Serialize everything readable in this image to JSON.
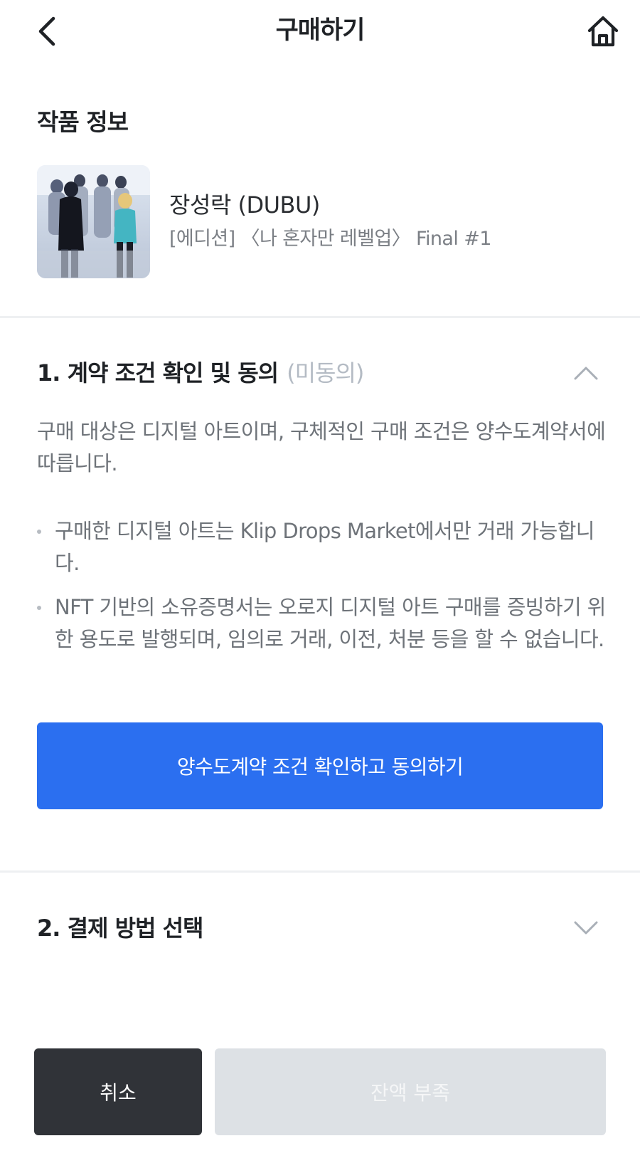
{
  "header": {
    "title": "구매하기",
    "back_icon": "chevron-left-icon",
    "home_icon": "home-icon"
  },
  "artwork_info": {
    "section_title": "작품 정보",
    "artist": "장성락 (DUBU)",
    "title": "[에디션] 〈나 혼자만 레벨업〉 Final #1"
  },
  "contract": {
    "title": "1. 계약 조건 확인 및 동의",
    "status": "(미동의)",
    "expanded": true,
    "description": "구매 대상은 디지털 아트이며, 구체적인 구매 조건은 양수도계약서에 따릅니다.",
    "bullets": [
      "구매한 디지털 아트는 Klip Drops Market에서만 거래 가능합니다.",
      "NFT 기반의 소유증명서는 오로지 디지털 아트 구매를 증빙하기 위한 용도로 발행되며, 임의로 거래, 이전, 처분 등을 할 수 없습니다."
    ],
    "agree_button": "양수도계약 조건 확인하고 동의하기"
  },
  "payment": {
    "title": "2. 결제 방법 선택",
    "expanded": false
  },
  "footer": {
    "cancel": "취소",
    "insufficient_balance": "잔액 부족"
  },
  "colors": {
    "primary": "#2b6ff0",
    "dark_button": "#303338",
    "disabled_button": "#dde1e5",
    "status_text": "#b4bbc4"
  }
}
